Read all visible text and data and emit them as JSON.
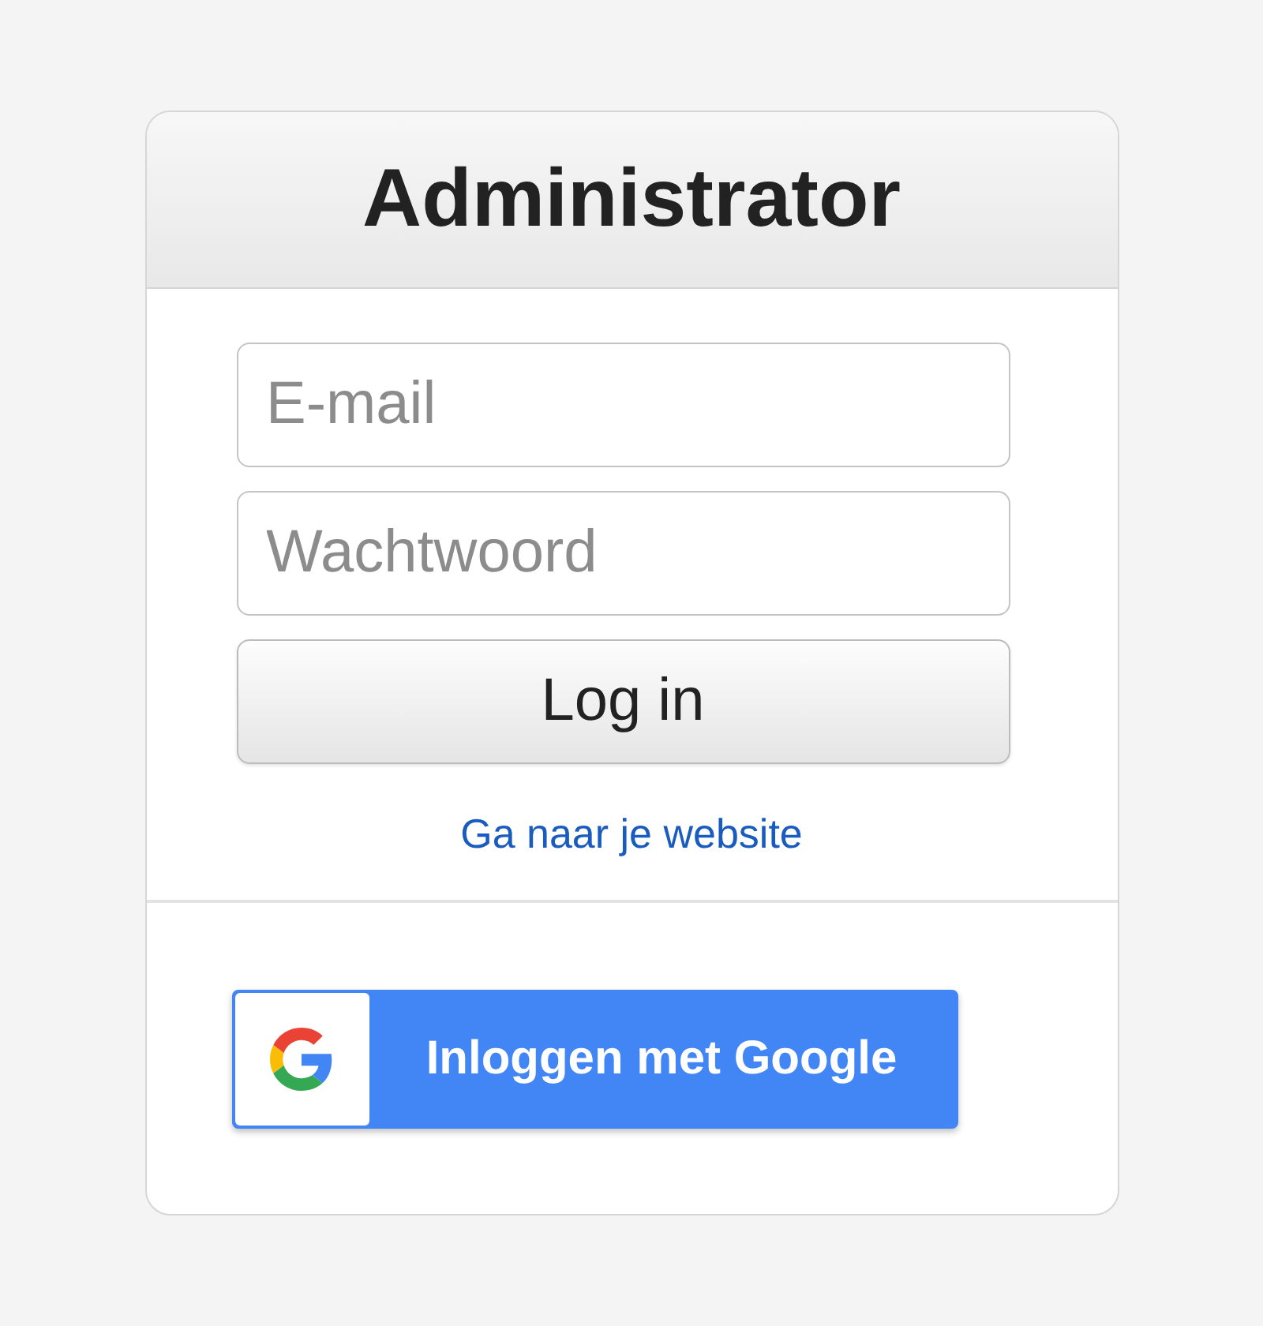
{
  "header": {
    "title": "Administrator"
  },
  "form": {
    "fields": [
      {
        "placeholder": "E-mail"
      },
      {
        "placeholder": "Wachtwoord"
      }
    ],
    "submit": {
      "label": "Log in"
    },
    "link": {
      "label": "Ga naar je website"
    }
  },
  "google_button": {
    "label": "Inloggen met Google"
  }
}
